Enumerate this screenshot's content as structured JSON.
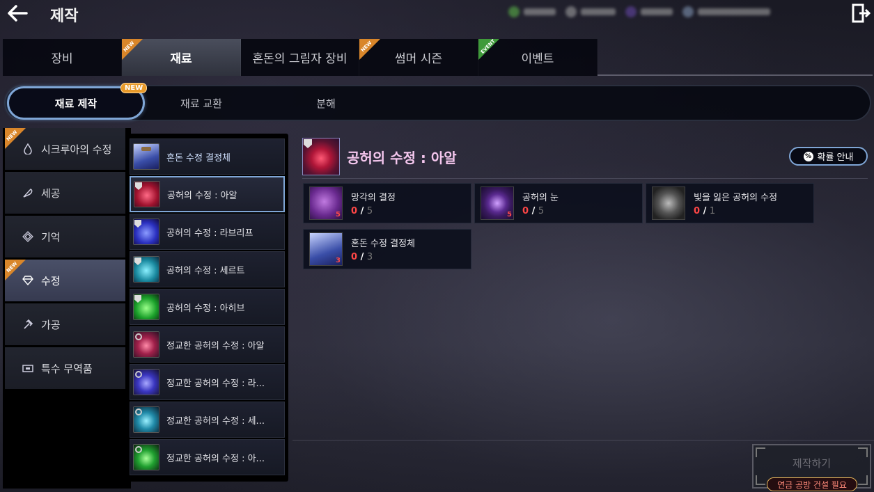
{
  "header": {
    "title": "제작"
  },
  "main_tabs": [
    {
      "label": "장비",
      "badge": ""
    },
    {
      "label": "재료",
      "badge": "NEW"
    },
    {
      "label": "혼돈의 그림자 장비",
      "badge": ""
    },
    {
      "label": "썸머 시즌",
      "badge": "NEW"
    },
    {
      "label": "이벤트",
      "badge": "EVENT"
    }
  ],
  "sub_tabs": [
    {
      "label": "재료 제작",
      "badge": "NEW"
    },
    {
      "label": "재료 교환"
    },
    {
      "label": "분해"
    }
  ],
  "categories": [
    {
      "label": "시크루아의 수정",
      "icon": "crystal-drop-icon",
      "badge": "NEW"
    },
    {
      "label": "세공",
      "icon": "feather-icon"
    },
    {
      "label": "기억",
      "icon": "memory-icon"
    },
    {
      "label": "수정",
      "icon": "diamond-icon",
      "badge": "NEW"
    },
    {
      "label": "가공",
      "icon": "hammer-icon"
    },
    {
      "label": "특수 무역품",
      "icon": "trade-icon"
    }
  ],
  "recipes": [
    {
      "label": "혼돈 수정 결정체",
      "color": "#5a78d8"
    },
    {
      "label": "공허의 수정 : 아알",
      "color": "#e0304a"
    },
    {
      "label": "공허의 수정 : 라브리프",
      "color": "#4f5ee8"
    },
    {
      "label": "공허의 수정 : 세르트",
      "color": "#2fb5c8"
    },
    {
      "label": "공허의 수정 : 아히브",
      "color": "#36c84a"
    },
    {
      "label": "정교한 공허의 수정 : 아알",
      "color": "#d84068"
    },
    {
      "label": "정교한 공허의 수정 : 라...",
      "color": "#5a5ae0"
    },
    {
      "label": "정교한 공허의 수정 : 세...",
      "color": "#3aa8c0"
    },
    {
      "label": "정교한 공허의 수정 : 아...",
      "color": "#40c050"
    }
  ],
  "detail": {
    "title": "공허의 수정 : 아알",
    "probability_label": "확률 안내",
    "materials": [
      {
        "name": "망각의 결정",
        "count_badge": "5",
        "have": "0",
        "sep": "/",
        "need": "5",
        "color": "#8a4ab0"
      },
      {
        "name": "공허의 눈",
        "count_badge": "5",
        "have": "0",
        "sep": "/",
        "need": "5",
        "color": "#6a3a90"
      },
      {
        "name": "빛을 잃은 공허의 수정",
        "count_badge": "",
        "have": "0",
        "sep": "/",
        "need": "1",
        "color": "#555555"
      },
      {
        "name": "혼돈 수정 결정체",
        "count_badge": "3",
        "have": "0",
        "sep": "/",
        "need": "3",
        "color": "#4a6ab0"
      }
    ]
  },
  "footer": {
    "craft_label": "제작하기",
    "requirement": "연금 공방 건설 필요"
  }
}
